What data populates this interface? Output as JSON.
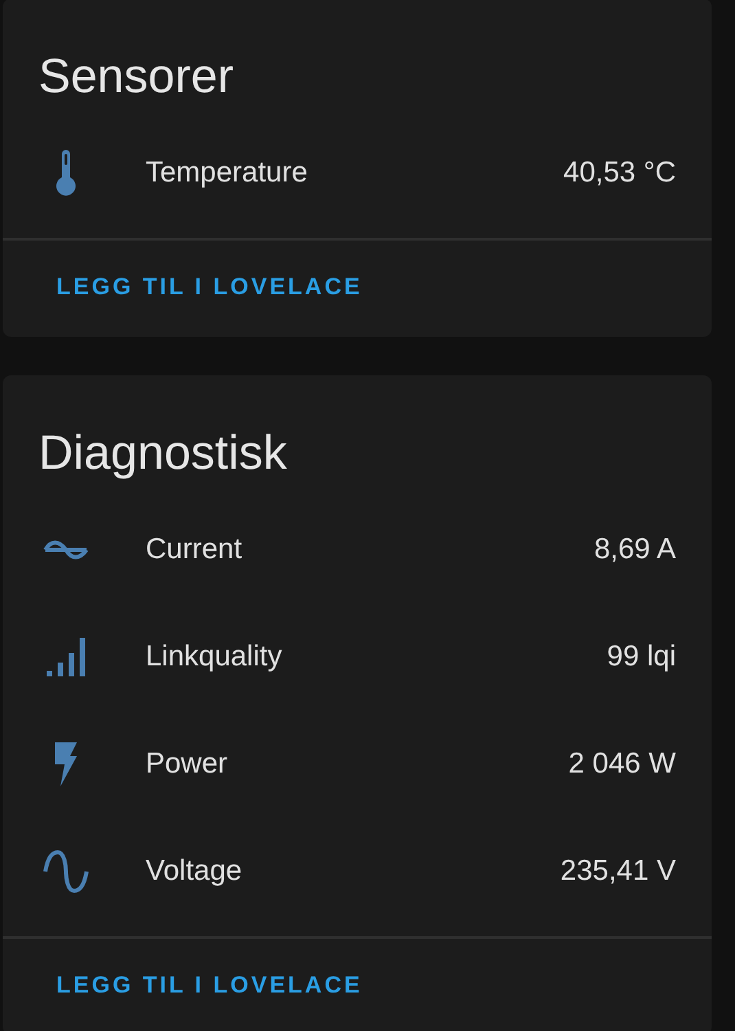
{
  "cards": [
    {
      "title": "Sensorer",
      "rows": [
        {
          "kind": "thermometer",
          "name": "Temperature",
          "value": "40,53 °C"
        }
      ],
      "button": "LEGG TIL I LOVELACE"
    },
    {
      "title": "Diagnostisk",
      "rows": [
        {
          "kind": "current",
          "name": "Current",
          "value": "8,69 A"
        },
        {
          "kind": "signal",
          "name": "Linkquality",
          "value": "99 lqi"
        },
        {
          "kind": "flash",
          "name": "Power",
          "value": "2 046 W"
        },
        {
          "kind": "sine",
          "name": "Voltage",
          "value": "235,41 V"
        }
      ],
      "button": "LEGG TIL I LOVELACE"
    }
  ]
}
